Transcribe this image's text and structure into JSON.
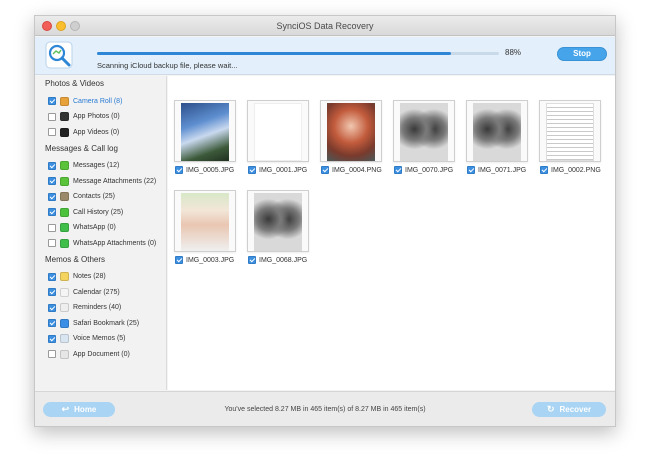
{
  "window": {
    "title": "SynciOS Data Recovery"
  },
  "scan": {
    "progress_percent": 88,
    "progress_label": "88%",
    "status": "Scanning iCloud backup file, please wait...",
    "stop_label": "Stop"
  },
  "sidebar": {
    "groups": [
      {
        "title": "Photos & Videos",
        "items": [
          {
            "label": "Camera Roll (8)",
            "checked": true,
            "active": true,
            "icon": "flower-icon",
            "color": "#e8a23a"
          },
          {
            "label": "App Photos (0)",
            "checked": false,
            "active": false,
            "icon": "camera-icon",
            "color": "#333333"
          },
          {
            "label": "App Videos (0)",
            "checked": false,
            "active": false,
            "icon": "clapper-icon",
            "color": "#222222"
          }
        ]
      },
      {
        "title": "Messages & Call log",
        "items": [
          {
            "label": "Messages (12)",
            "checked": true,
            "active": false,
            "icon": "speech-bubble-icon",
            "color": "#5ac33a"
          },
          {
            "label": "Message Attachments (22)",
            "checked": true,
            "active": false,
            "icon": "paperclip-icon",
            "color": "#5ac33a"
          },
          {
            "label": "Contacts (25)",
            "checked": true,
            "active": false,
            "icon": "contacts-book-icon",
            "color": "#9a8a6a"
          },
          {
            "label": "Call History (25)",
            "checked": true,
            "active": false,
            "icon": "phone-icon",
            "color": "#4cc23c"
          },
          {
            "label": "WhatsApp (0)",
            "checked": false,
            "active": false,
            "icon": "whatsapp-icon",
            "color": "#3fbf4a"
          },
          {
            "label": "WhatsApp Attachments (0)",
            "checked": false,
            "active": false,
            "icon": "whatsapp-attachment-icon",
            "color": "#3fbf4a"
          }
        ]
      },
      {
        "title": "Memos & Others",
        "items": [
          {
            "label": "Notes (28)",
            "checked": true,
            "active": false,
            "icon": "notes-icon",
            "color": "#f4d35e"
          },
          {
            "label": "Calendar (275)",
            "checked": true,
            "active": false,
            "icon": "calendar-icon",
            "color": "#f5f5f5"
          },
          {
            "label": "Reminders (40)",
            "checked": true,
            "active": false,
            "icon": "reminders-icon",
            "color": "#eeeeee"
          },
          {
            "label": "Safari Bookmark (25)",
            "checked": true,
            "active": false,
            "icon": "compass-icon",
            "color": "#3a8ee6"
          },
          {
            "label": "Voice Memos (5)",
            "checked": true,
            "active": false,
            "icon": "waveform-icon",
            "color": "#d9e6f2"
          },
          {
            "label": "App Document (0)",
            "checked": false,
            "active": false,
            "icon": "document-icon",
            "color": "#e6e6e6"
          }
        ]
      }
    ]
  },
  "thumbnails": [
    {
      "name": "IMG_0005.JPG",
      "checked": true,
      "style": "photo-balloon"
    },
    {
      "name": "IMG_0001.JPG",
      "checked": true,
      "style": "blank"
    },
    {
      "name": "IMG_0004.PNG",
      "checked": true,
      "style": "photo-portrait"
    },
    {
      "name": "IMG_0070.JPG",
      "checked": true,
      "style": "blur"
    },
    {
      "name": "IMG_0071.JPG",
      "checked": true,
      "style": "blur"
    },
    {
      "name": "IMG_0002.PNG",
      "checked": true,
      "style": "document"
    },
    {
      "name": "IMG_0003.JPG",
      "checked": true,
      "style": "photo-hat"
    },
    {
      "name": "IMG_0068.JPG",
      "checked": true,
      "style": "blur"
    }
  ],
  "footer": {
    "home_label": "Home",
    "recover_label": "Recover",
    "summary": "You've selected 8.27 MB in 465 item(s) of 8.27 MB in 465 item(s)"
  },
  "colors": {
    "accent": "#3d8fe0",
    "button_disabled": "#a9d4f3",
    "stop_button": "#46a5ea"
  }
}
